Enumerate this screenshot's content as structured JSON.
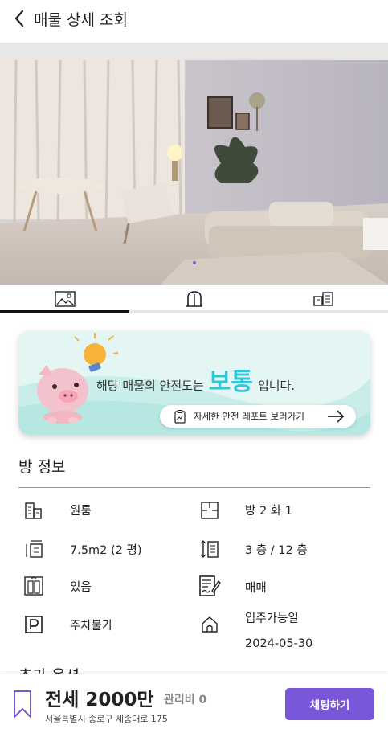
{
  "header": {
    "title": "매물 상세 조회",
    "back_icon": "chevron-left-icon"
  },
  "photo": {
    "description_icon": "room-photo",
    "carousel_index": 1
  },
  "tabs": [
    {
      "icon": "image-icon",
      "active": true
    },
    {
      "icon": "door-icon",
      "active": false
    },
    {
      "icon": "building-icon",
      "active": false
    }
  ],
  "banner": {
    "prefix": "해당 매물의 안전도는",
    "level": "보통",
    "suffix": "입니다.",
    "report_label": "자세한 안전 레포트 보러가기",
    "accent_color": "#31c6d8"
  },
  "room_info": {
    "title": "방 정보",
    "items": [
      {
        "icon": "building-icon",
        "value": "원룸"
      },
      {
        "icon": "floorplan-icon",
        "value": "방 2 화 1"
      },
      {
        "icon": "area-icon",
        "value": "7.5m2 (2 평)"
      },
      {
        "icon": "floor-icon",
        "value": "3 층 / 12 층"
      },
      {
        "icon": "elevator-icon",
        "value": "있음"
      },
      {
        "icon": "contract-icon",
        "value": "매매"
      },
      {
        "icon": "parking-icon",
        "value": "주차불가"
      },
      {
        "icon": "home-icon",
        "value": "입주가능일",
        "value2": "2024-05-30"
      }
    ]
  },
  "extra_options": {
    "title": "추가 옵션"
  },
  "bottom": {
    "price": "전세 2000만",
    "fee": "관리비 0",
    "address": "서울특별시 종로구 세종대로 175",
    "chat_label": "채팅하기",
    "button_color": "#7a56d9"
  }
}
